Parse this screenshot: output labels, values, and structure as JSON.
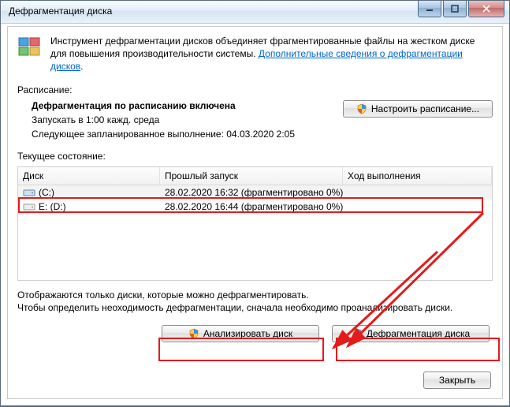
{
  "window": {
    "title": "Дефрагментация диска"
  },
  "intro": {
    "text_before_link": "Инструмент дефрагментации дисков объединяет фрагментированные файлы на жестком диске для повышения производительности системы. ",
    "link": "Дополнительные сведения о дефрагментации дисков",
    "text_after_link": "."
  },
  "schedule": {
    "section_label": "Расписание:",
    "heading": "Дефрагментация по расписанию включена",
    "run_at": "Запускать в 1:00 кажд. среда",
    "next_run": "Следующее запланированное выполнение: 04.03.2020 2:05",
    "configure_btn": "Настроить расписание..."
  },
  "state": {
    "section_label": "Текущее состояние:",
    "columns": {
      "disk": "Диск",
      "last": "Прошлый запуск",
      "progress": "Ход выполнения"
    },
    "rows": [
      {
        "name": "(C:)",
        "last": "28.02.2020 16:32 (фрагментировано 0%)",
        "progress": "",
        "icon": "hdd",
        "selected": true
      },
      {
        "name": "E: (D:)",
        "last": "28.02.2020 16:44 (фрагментировано 0%)",
        "progress": "",
        "icon": "hdd2",
        "selected": false
      }
    ]
  },
  "note": {
    "line1": "Отображаются только диски, которые можно дефрагментировать.",
    "line2": "Чтобы определить неоходимость  дефрагментации, сначала необходимо проанализировать диски."
  },
  "buttons": {
    "analyze": "Анализировать диск",
    "defrag": "Дефрагментация диска",
    "close": "Закрыть"
  },
  "colors": {
    "annotation": "#e31b1b",
    "link": "#0066cc"
  }
}
